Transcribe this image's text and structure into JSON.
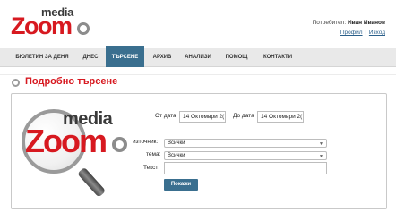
{
  "header": {
    "logo": {
      "top": "media",
      "main": "Zoom"
    },
    "user_label": "Потребител:",
    "user_name": "Иван Иванов",
    "profile_link": "Профил",
    "separator": "|",
    "logout_link": "Изход"
  },
  "nav": {
    "items": [
      {
        "label": "БЮЛЕТИН ЗА ДЕНЯ",
        "active": false
      },
      {
        "label": "ДНЕС",
        "active": false
      },
      {
        "label": "ТЪРСЕНЕ",
        "active": true
      },
      {
        "label": "АРХИВ",
        "active": false
      },
      {
        "label": "АНАЛИЗИ",
        "active": false
      },
      {
        "label": "ПОМОЩ",
        "active": false
      },
      {
        "label": "КОНТАКТИ",
        "active": false
      }
    ],
    "active_color": "#3a6f8f"
  },
  "page": {
    "title": "Подробно търсене",
    "title_color": "#d71920"
  },
  "search_logo": {
    "top": "media",
    "main": "Zoom"
  },
  "form": {
    "from_label": "От дата",
    "from_value": "14 Октомври 2(",
    "to_label": "До дата",
    "to_value": "14 Октомври 2(",
    "source_label": "източник:",
    "source_value": "Всички",
    "topic_label": "тема:",
    "topic_value": "Всички",
    "text_label": "Текст:",
    "text_value": "",
    "submit_label": "Покажи"
  },
  "colors": {
    "brand_red": "#d71920",
    "accent_blue": "#3a6f8f"
  },
  "icons": [
    "magnifier-logo-icon",
    "ring-bullet-icon",
    "chevron-down-icon"
  ]
}
